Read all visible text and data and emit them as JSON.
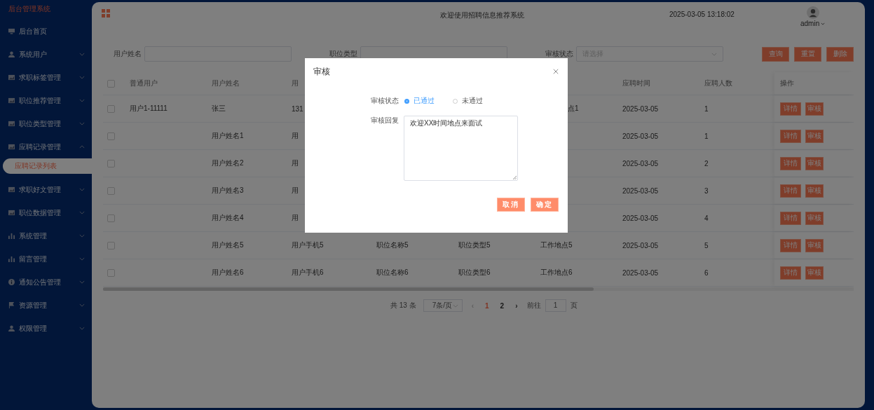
{
  "sidebar": {
    "title": "后台管理系统",
    "items": [
      {
        "label": "后台首页"
      },
      {
        "label": "系统用户",
        "expanded": false
      },
      {
        "label": "求职标签管理",
        "expanded": false
      },
      {
        "label": "职位推荐管理",
        "expanded": false
      },
      {
        "label": "职位类型管理",
        "expanded": false
      },
      {
        "label": "应聘记录管理",
        "expanded": true,
        "children": [
          {
            "label": "应聘记录列表",
            "selected": true
          }
        ]
      },
      {
        "label": "求职好文管理",
        "expanded": false
      },
      {
        "label": "职位数据管理",
        "expanded": false
      },
      {
        "label": "系统管理",
        "expanded": false
      },
      {
        "label": "留言管理",
        "expanded": false
      },
      {
        "label": "通知公告管理",
        "expanded": false
      },
      {
        "label": "资源管理",
        "expanded": false
      },
      {
        "label": "权限管理",
        "expanded": false
      }
    ]
  },
  "header": {
    "title": "欢迎使用招聘信息推荐系统",
    "datetime": "2025-03-05 13:18:02",
    "user": "admin"
  },
  "filters": [
    {
      "label": "用户姓名",
      "kind": "input"
    },
    {
      "label": "职位类型",
      "kind": "input"
    },
    {
      "label": "审核状态",
      "kind": "select",
      "placeholder": "请选择"
    }
  ],
  "filter_buttons": [
    "查询",
    "重置",
    "删除"
  ],
  "table": {
    "all_checked": false,
    "columns": [
      "普通用户",
      "用户姓名",
      "用",
      null,
      null,
      null,
      "应聘时间",
      "应聘人数",
      "操作"
    ],
    "rows": [
      {
        "checked": false,
        "cells": [
          "用户1-11111",
          "张三",
          "131",
          null,
          null,
          {
            "text": "点1",
            "kind": "tail"
          },
          "2025-03-05",
          "1"
        ],
        "actions": [
          "详情",
          "审核"
        ]
      },
      {
        "checked": false,
        "cells": [
          null,
          "用户姓名1",
          "用",
          null,
          null,
          null,
          "2025-03-05",
          "1"
        ],
        "actions": [
          "详情",
          "审核"
        ]
      },
      {
        "checked": false,
        "cells": [
          null,
          "用户姓名2",
          "用",
          null,
          null,
          null,
          "2025-03-05",
          "2"
        ],
        "actions": [
          "详情",
          "审核"
        ]
      },
      {
        "checked": false,
        "cells": [
          null,
          "用户姓名3",
          "用",
          null,
          null,
          null,
          "2025-03-05",
          "3"
        ],
        "actions": [
          "详情",
          "审核"
        ]
      },
      {
        "checked": false,
        "cells": [
          null,
          "用户姓名4",
          "用",
          null,
          null,
          null,
          "2025-03-05",
          "4"
        ],
        "actions": [
          "详情",
          "审核"
        ]
      },
      {
        "checked": false,
        "cells": [
          null,
          "用户姓名5",
          "用户手机5",
          "职位名称5",
          "职位类型5",
          "工作地点5",
          "2025-03-05",
          "5"
        ],
        "actions": [
          "详情",
          "审核"
        ]
      },
      {
        "checked": false,
        "cells": [
          null,
          "用户姓名6",
          "用户手机6",
          "职位名称6",
          "职位类型6",
          "工作地点6",
          "2025-03-05",
          "6"
        ],
        "actions": [
          "详情",
          "审核"
        ]
      }
    ]
  },
  "pagination": {
    "total": "共 13 条",
    "page_size": "7条/页",
    "prev": "‹",
    "pages": [
      {
        "label": "1",
        "selected": true
      },
      {
        "label": "2",
        "selected": false
      }
    ],
    "next": "›",
    "goto_label": "前往",
    "goto_value": "1",
    "goto_suffix": "页"
  },
  "dialog": {
    "title": "审核",
    "fields": [
      {
        "label": "审核状态",
        "kind": "radio",
        "options": [
          {
            "label": "已通过",
            "selected": true
          },
          {
            "label": "未通过",
            "selected": false
          }
        ]
      },
      {
        "label": "审核回复",
        "kind": "textarea",
        "value": "欢迎XX时间地点来面试"
      }
    ],
    "buttons": [
      "取消",
      "确定"
    ]
  }
}
